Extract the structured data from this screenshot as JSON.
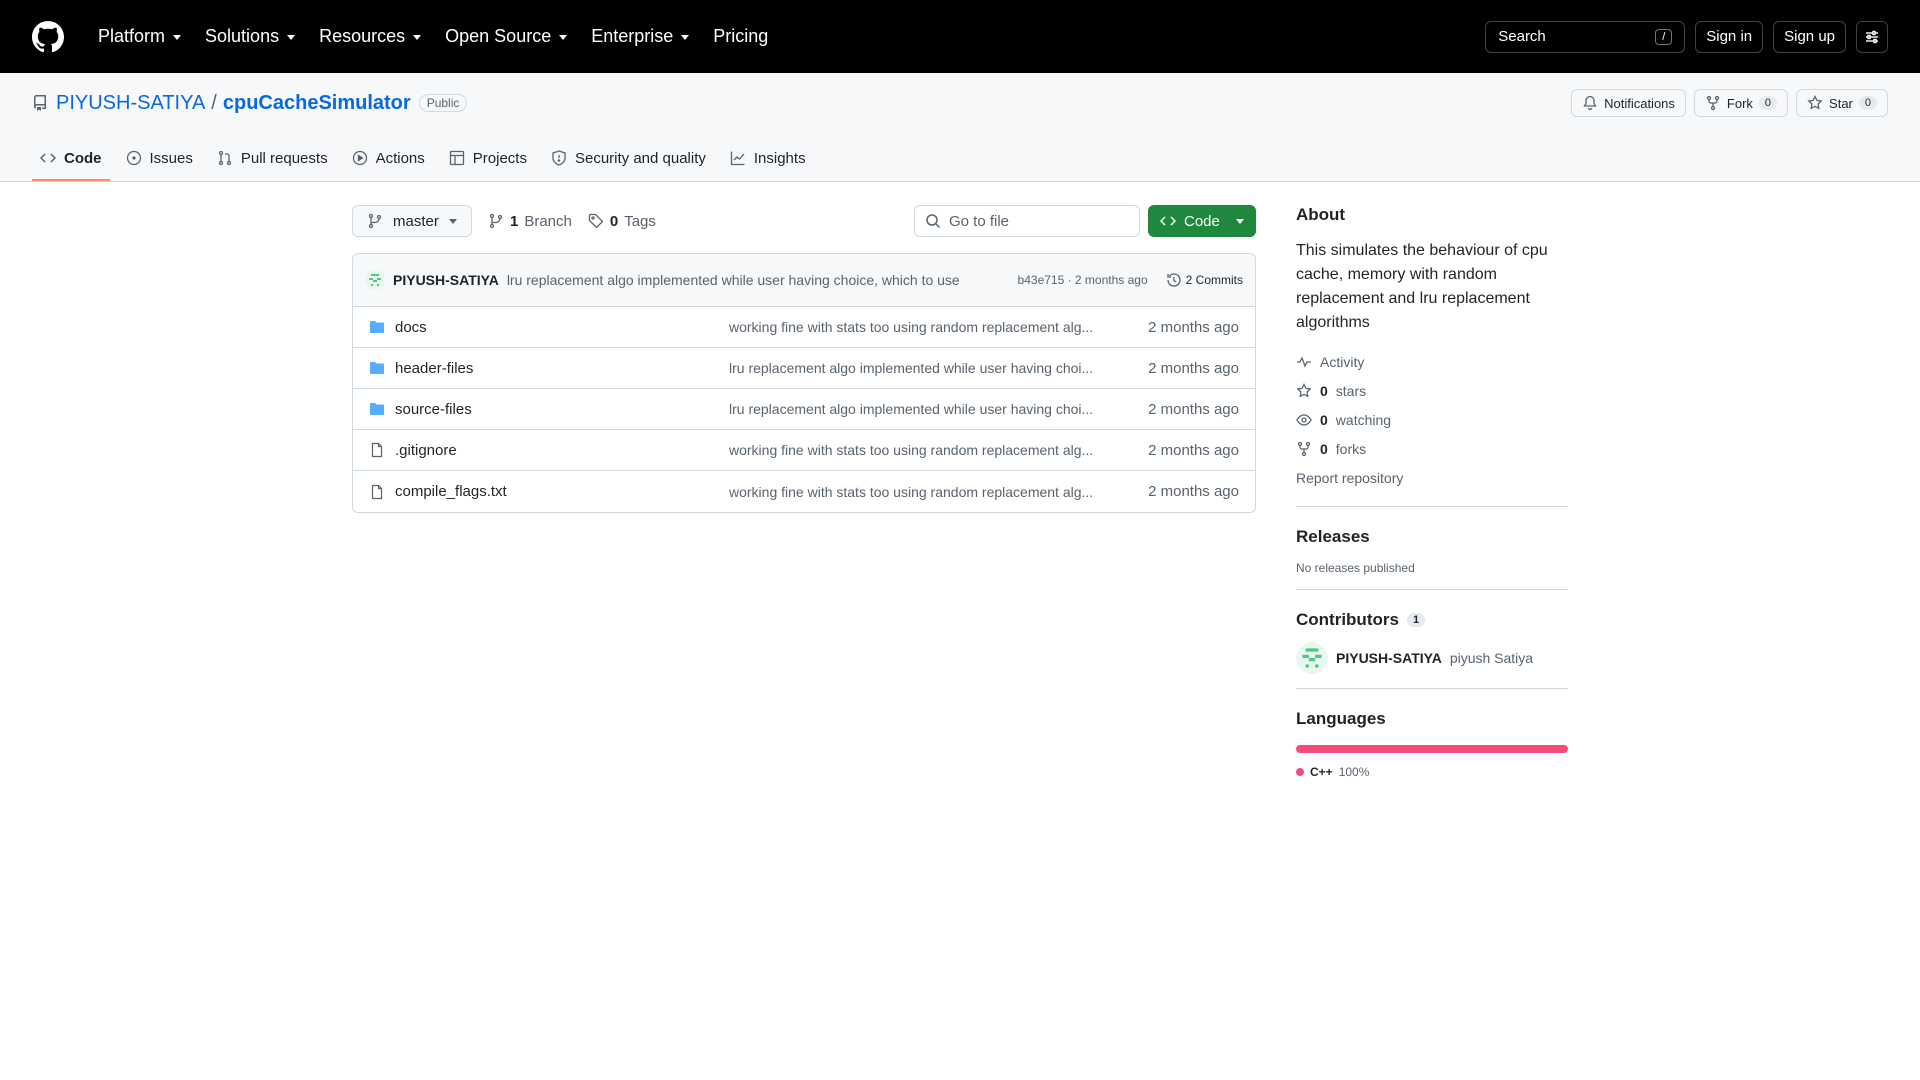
{
  "header": {
    "nav": [
      "Platform",
      "Solutions",
      "Resources",
      "Open Source",
      "Enterprise",
      "Pricing"
    ],
    "search_label": "Search",
    "search_shortcut": "/",
    "signin": "Sign in",
    "signup": "Sign up"
  },
  "repo": {
    "owner": "PIYUSH-SATIYA",
    "separator": "/",
    "name": "cpuCacheSimulator",
    "visibility": "Public",
    "notifications": "Notifications",
    "fork_label": "Fork",
    "fork_count": "0",
    "star_label": "Star",
    "star_count": "0"
  },
  "tabs": [
    "Code",
    "Issues",
    "Pull requests",
    "Actions",
    "Projects",
    "Security and quality",
    "Insights"
  ],
  "toolbar": {
    "branch": "master",
    "branches_count": "1",
    "branches_label": "Branch",
    "tags_count": "0",
    "tags_label": "Tags",
    "goto_placeholder": "Go to file",
    "code_button": "Code"
  },
  "latest_commit": {
    "author": "PIYUSH-SATIYA",
    "message": "lru replacement algo implemented while user having choice, which to use",
    "meta": "b43e715 · 2 months ago",
    "commits": "2 Commits"
  },
  "files": [
    {
      "name": "docs",
      "type": "folder",
      "message": "working fine with stats too using random replacement alg...",
      "date": "2 months ago"
    },
    {
      "name": "header-files",
      "type": "folder",
      "message": "lru replacement algo implemented while user having choi...",
      "date": "2 months ago"
    },
    {
      "name": "source-files",
      "type": "folder",
      "message": "lru replacement algo implemented while user having choi...",
      "date": "2 months ago"
    },
    {
      "name": ".gitignore",
      "type": "file",
      "message": "working fine with stats too using random replacement alg...",
      "date": "2 months ago"
    },
    {
      "name": "compile_flags.txt",
      "type": "file",
      "message": "working fine with stats too using random replacement alg...",
      "date": "2 months ago"
    }
  ],
  "about": {
    "title": "About",
    "description": "This simulates the behaviour of cpu cache, memory with random replacement and lru replacement algorithms",
    "activity": "Activity",
    "stars_count": "0",
    "stars_label": "stars",
    "watching_count": "0",
    "watching_label": "watching",
    "forks_count": "0",
    "forks_label": "forks",
    "report": "Report repository"
  },
  "releases": {
    "title": "Releases",
    "text": "No releases published"
  },
  "contributors": {
    "title": "Contributors",
    "count": "1",
    "login": "PIYUSH-SATIYA",
    "name": "piyush Satiya"
  },
  "languages": {
    "title": "Languages",
    "items": [
      {
        "name": "C++",
        "percent": "100%",
        "color": "#f34b7d"
      }
    ]
  },
  "colors": {
    "accent_link": "#0969da",
    "code_button": "#1f883d",
    "tab_underline": "#fd8c73",
    "cpp": "#f34b7d"
  }
}
